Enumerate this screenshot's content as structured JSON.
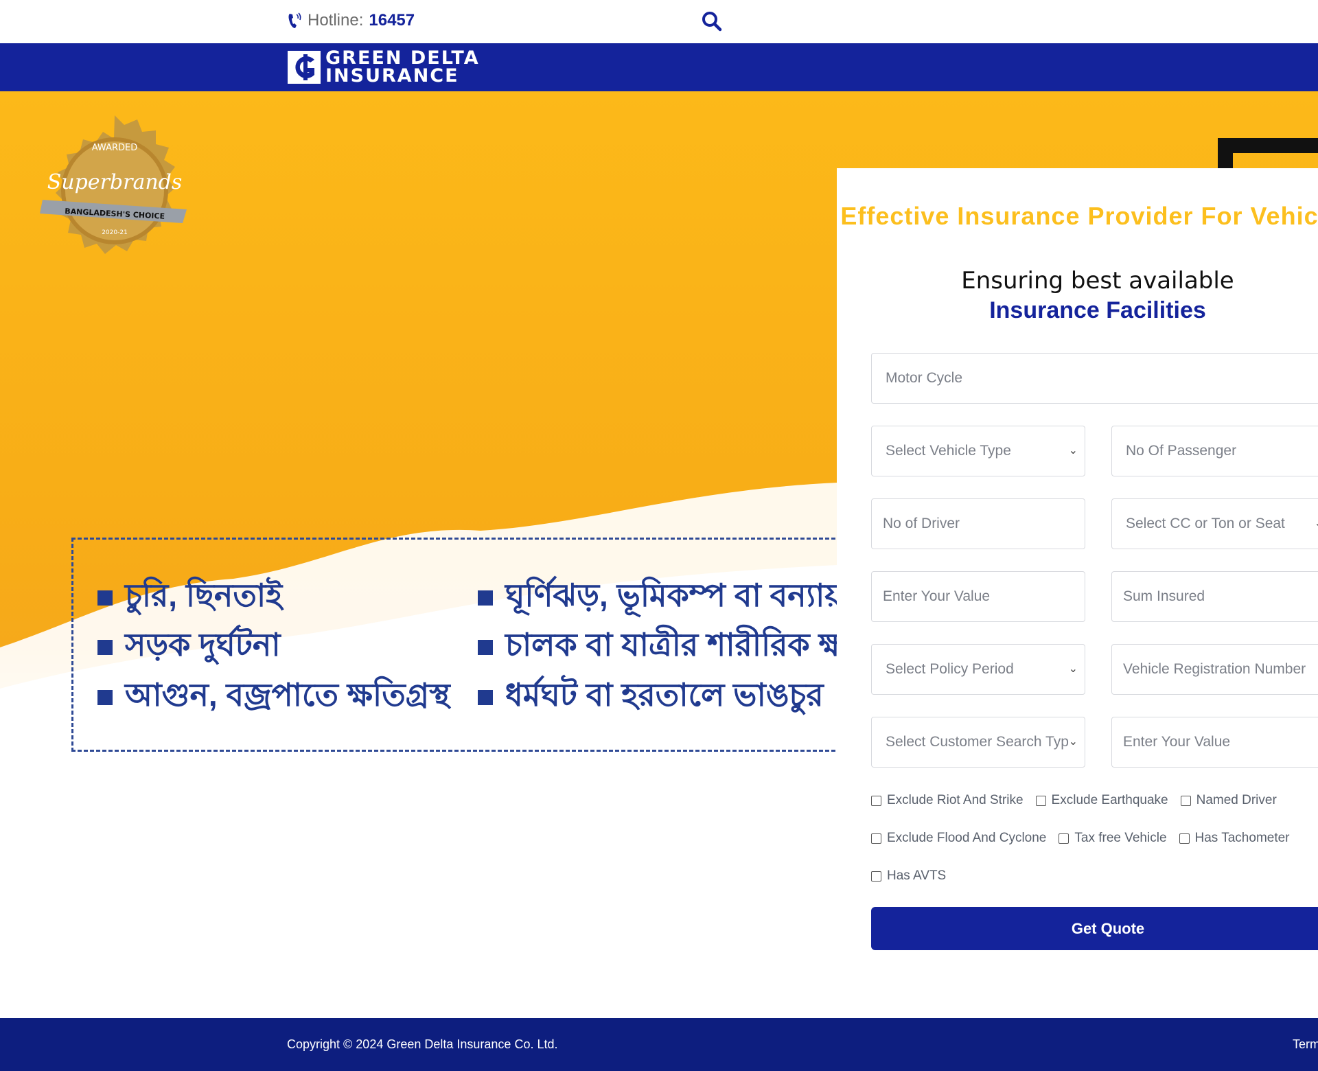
{
  "colors": {
    "brand_blue": "#14239b",
    "accent_yellow": "#fcbf1e",
    "hero_orange": "#f8ad17"
  },
  "topbar": {
    "hotline_label": "Hotline:",
    "hotline_number": "16457",
    "phone_icon": "phone-icon",
    "search_icon": "search-icon"
  },
  "brand": {
    "line1": "GREEN DELTA",
    "line2": "INSURANCE"
  },
  "badge": {
    "top": "AWARDED",
    "name": "Superbrands",
    "ribbon": "BANGLADESH'S CHOICE",
    "year": "2020-21"
  },
  "features": {
    "left": [
      "চুরি, ছিনতাই",
      "সড়ক দুর্ঘটনা",
      "আগুন, বজ্রপাতে ক্ষতিগ্রস্থ"
    ],
    "right": [
      "ঘূর্ণিঝড়, ভূমিকম্প বা বন্যায়",
      "চালক বা যাত্রীর শারীরিক ক্ষ",
      "ধর্মঘট বা হরতালে ভাঙচুর"
    ]
  },
  "form": {
    "title": "Effective Insurance Provider For Vehicles",
    "subtitle": "Ensuring best available",
    "subtitle_bold": "Insurance Facilities",
    "category_select": "Motor Cycle",
    "vehicle_type": "Select Vehicle Type",
    "passengers": "No Of Passenger",
    "drivers": "No of Driver",
    "cc_select": "Select CC or Ton or Seat",
    "value_1": "Enter Your Value",
    "sum_insured": "Sum Insured",
    "policy_period": "Select Policy Period",
    "registration": "Vehicle Registration Number",
    "customer_search": "Select Customer Search Typ",
    "value_2": "Enter Your Value",
    "checks_row1": [
      "Exclude Riot And Strike",
      "Exclude Earthquake",
      "Named Driver"
    ],
    "checks_row2": [
      "Exclude Flood And Cyclone",
      "Tax free Vehicle",
      "Has Tachometer"
    ],
    "checks_row3": [
      "Has AVTS"
    ],
    "submit": "Get Quote"
  },
  "footer": {
    "copyright": "Copyright © 2024 Green Delta Insurance Co. Ltd.",
    "terms": "Term"
  }
}
